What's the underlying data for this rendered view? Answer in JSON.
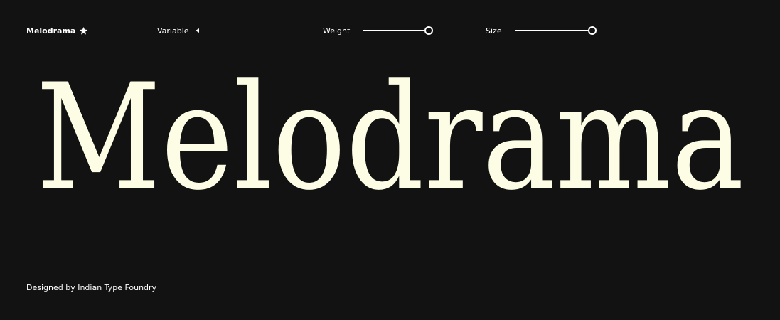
{
  "header": {
    "font_name": "Melodrama",
    "favorite_icon": "star-icon",
    "style_select": {
      "label": "Variable",
      "icon": "caret-left-icon"
    },
    "weight": {
      "label": "Weight",
      "value": 1.0
    },
    "size": {
      "label": "Size",
      "value": 1.0
    }
  },
  "specimen": {
    "text": "Melodrama",
    "color": "#fdfde6"
  },
  "footer": {
    "credit": "Designed by Indian Type Foundry"
  },
  "colors": {
    "background": "#121212",
    "foreground": "#ffffff",
    "specimen": "#fdfde6"
  }
}
